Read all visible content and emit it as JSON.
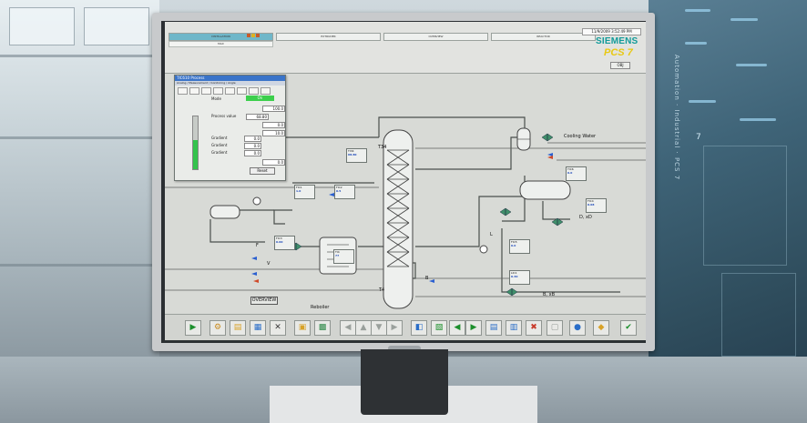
{
  "monitor": {
    "brand_logo": "SIEMENS",
    "product_logo": "PCS 7",
    "date_time": "11/9/2009 3:52:49 PM"
  },
  "background": {
    "vertical_label": "Automation · Industrial · PCS 7",
    "panel_number": "7"
  },
  "header": {
    "areas": [
      {
        "label": "DISTILLATION",
        "active": true
      },
      {
        "label": "EXTRUDER",
        "active": false
      },
      {
        "label": "OVERVIEW",
        "active": false
      },
      {
        "label": "REACTOR",
        "active": false
      }
    ],
    "sub_area": "MAX",
    "object_button": "OBJ"
  },
  "faceplate": {
    "title": "TIC610 Process",
    "tab_label": "Analog / Measurement / monitoring / Angle",
    "mode_label": "Mode",
    "mode_value": "On",
    "process_value_label": "Process value",
    "process_value": "68.80",
    "value_top": "100.0",
    "value_mid": "0.0",
    "value_upper": "10.0",
    "gradient_label": "Gradient",
    "gradient_1": "0.0",
    "gradient_2": "0.0",
    "gradient_3": "0.0",
    "value_low": "0.0",
    "reset_label": "Reset",
    "level_fraction": 0.55
  },
  "process": {
    "column_top_label": "T34",
    "column_bottom_label": "T4",
    "cooling_water_label": "Cooling Water",
    "distillate_label": "D, xD",
    "bottoms_label": "B, xB",
    "bottoms_short": "B",
    "reboiler_label": "Reboiler",
    "f_label": "F",
    "v_label": "V",
    "l_label": "L",
    "tag_col_top": {
      "name": "TI34",
      "value": "68.80"
    },
    "tag_feed_1": {
      "name": "FIC1",
      "value": "1.0"
    },
    "tag_feed_2": {
      "name": "FIC2",
      "value": "0.5"
    },
    "tag_steam": {
      "name": "FIC3",
      "value": "0.00"
    },
    "tag_bottom": {
      "name": "TI4",
      "value": "77"
    },
    "tag_distillate": {
      "name": "FIC4",
      "value": "0.08"
    },
    "tag_reflux": {
      "name": "FIC5",
      "value": "0.0"
    },
    "tag_level": {
      "name": "LIC1",
      "value": "0.30"
    },
    "tag_cw": {
      "name": "TIC6",
      "value": "0.0"
    }
  },
  "overview_button": "OVERVIEW",
  "toolbar": {
    "buttons": [
      "start-icon",
      "group-icon",
      "folder-icon",
      "picture-icon",
      "split-icon",
      "screen-icon",
      "tree-icon",
      "arrow-left-icon",
      "arrow-up-icon",
      "arrow-down-icon",
      "arrow-right-icon",
      "save-icon",
      "print-icon",
      "back-icon",
      "forward-icon",
      "store-icon",
      "load-icon",
      "delete-icon",
      "cancel-icon",
      "info-icon",
      "horn-icon",
      "ack-icon"
    ]
  },
  "colors": {
    "screen_bg": "#d8dad6",
    "accent_blue": "#1b47b8",
    "status_green": "#3ccf4c",
    "siemens_teal": "#129b9a",
    "pcs7_yellow": "#e8c812"
  }
}
